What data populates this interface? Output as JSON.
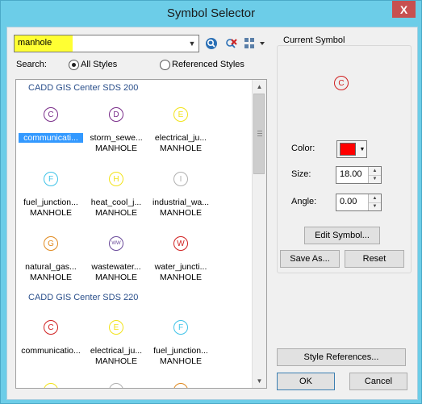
{
  "window": {
    "title": "Symbol Selector",
    "close_glyph": "X"
  },
  "search": {
    "value": "manhole",
    "highlight_color": "#ffff33"
  },
  "toolbar": {
    "search_icon": "magnifier-icon",
    "clear_icon": "clear-search-icon",
    "view_icon": "view-options-icon"
  },
  "scope": {
    "label": "Search:",
    "options": [
      {
        "label": "All Styles",
        "checked": true
      },
      {
        "label": "Referenced Styles",
        "checked": false
      }
    ]
  },
  "groups": [
    {
      "header": "CADD GIS Center SDS 200",
      "symbols": [
        {
          "letter": "C",
          "color": "#7a2e8a",
          "name": "communicati...",
          "category": "",
          "selected": true
        },
        {
          "letter": "D",
          "color": "#7a2e8a",
          "name": "storm_sewe...",
          "category": "MANHOLE"
        },
        {
          "letter": "E",
          "color": "#f2e31a",
          "name": "electrical_ju...",
          "category": "MANHOLE"
        },
        {
          "letter": "F",
          "color": "#3fc3e8",
          "name": "fuel_junction...",
          "category": "MANHOLE"
        },
        {
          "letter": "H",
          "color": "#f2e31a",
          "name": "heat_cool_j...",
          "category": "MANHOLE"
        },
        {
          "letter": "I",
          "color": "#b0b0b0",
          "name": "industrial_wa...",
          "category": "MANHOLE"
        },
        {
          "letter": "G",
          "color": "#e08a20",
          "name": "natural_gas...",
          "category": "MANHOLE"
        },
        {
          "letter": "WW",
          "color": "#6a4a9a",
          "name": "wastewater...",
          "category": "MANHOLE"
        },
        {
          "letter": "W",
          "color": "#d02020",
          "name": "water_juncti...",
          "category": "MANHOLE"
        }
      ]
    },
    {
      "header": "CADD GIS Center SDS 220",
      "symbols": [
        {
          "letter": "C",
          "color": "#d02020",
          "name": "communicatio...",
          "category": ""
        },
        {
          "letter": "E",
          "color": "#f2e31a",
          "name": "electrical_ju...",
          "category": "MANHOLE"
        },
        {
          "letter": "F",
          "color": "#3fc3e8",
          "name": "fuel_junction...",
          "category": "MANHOLE"
        }
      ]
    }
  ],
  "current_symbol": {
    "title": "Current Symbol",
    "preview_letter": "C",
    "color_label": "Color:",
    "color_value": "#ff0000",
    "size_label": "Size:",
    "size_value": "18.00",
    "angle_label": "Angle:",
    "angle_value": "0.00",
    "edit_button": "Edit Symbol...",
    "save_button": "Save As...",
    "reset_button": "Reset"
  },
  "footer": {
    "style_refs_button": "Style References...",
    "ok_button": "OK",
    "cancel_button": "Cancel"
  }
}
